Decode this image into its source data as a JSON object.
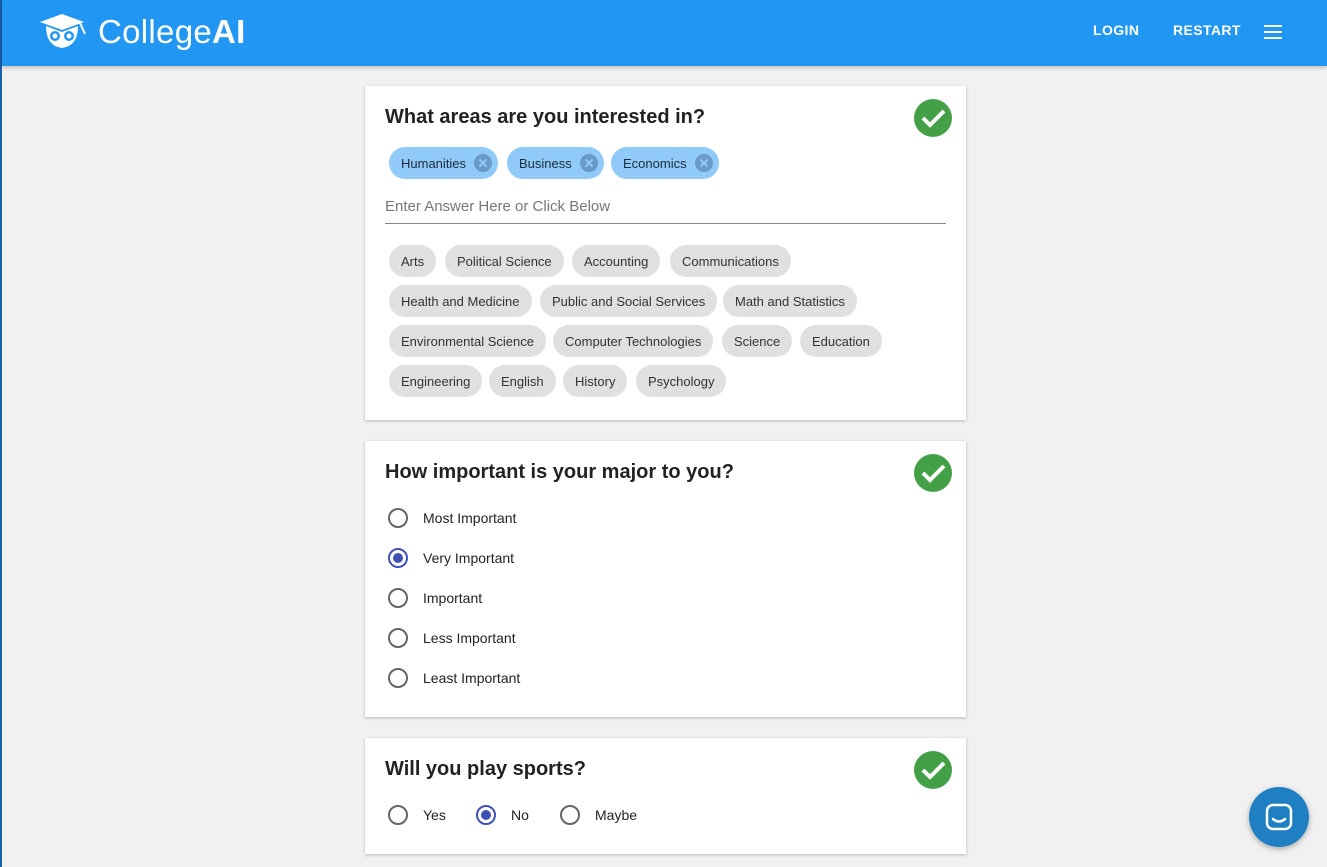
{
  "header": {
    "brand_light": "College",
    "brand_bold": "AI",
    "login": "LOGIN",
    "restart": "RESTART"
  },
  "colors": {
    "appbar": "#2196f3",
    "check": "#43a047",
    "radio_selected": "#3f51b5",
    "chip_selected": "#90caf9"
  },
  "interests": {
    "question": "What areas are you interested in?",
    "selected": [
      "Humanities",
      "Business",
      "Economics"
    ],
    "placeholder": "Enter Answer Here or Click Below",
    "options": [
      [
        "Arts",
        "Political Science",
        "Accounting",
        "Communications"
      ],
      [
        "Health and Medicine",
        "Public and Social Services",
        "Math and Statistics"
      ],
      [
        "Environmental Science",
        "Computer Technologies",
        "Science",
        "Education"
      ],
      [
        "Engineering",
        "English",
        "History",
        "Psychology"
      ]
    ]
  },
  "major": {
    "question": "How important is your major to you?",
    "options": [
      "Most Important",
      "Very Important",
      "Important",
      "Less Important",
      "Least Important"
    ],
    "selected": "Very Important"
  },
  "sports": {
    "question": "Will you play sports?",
    "options": [
      "Yes",
      "No",
      "Maybe"
    ],
    "selected": "No"
  },
  "icons": {
    "logo": "owl-grad-cap-icon",
    "menu": "hamburger-menu-icon",
    "check": "checkmark-icon",
    "chat": "chat-messenger-icon"
  }
}
